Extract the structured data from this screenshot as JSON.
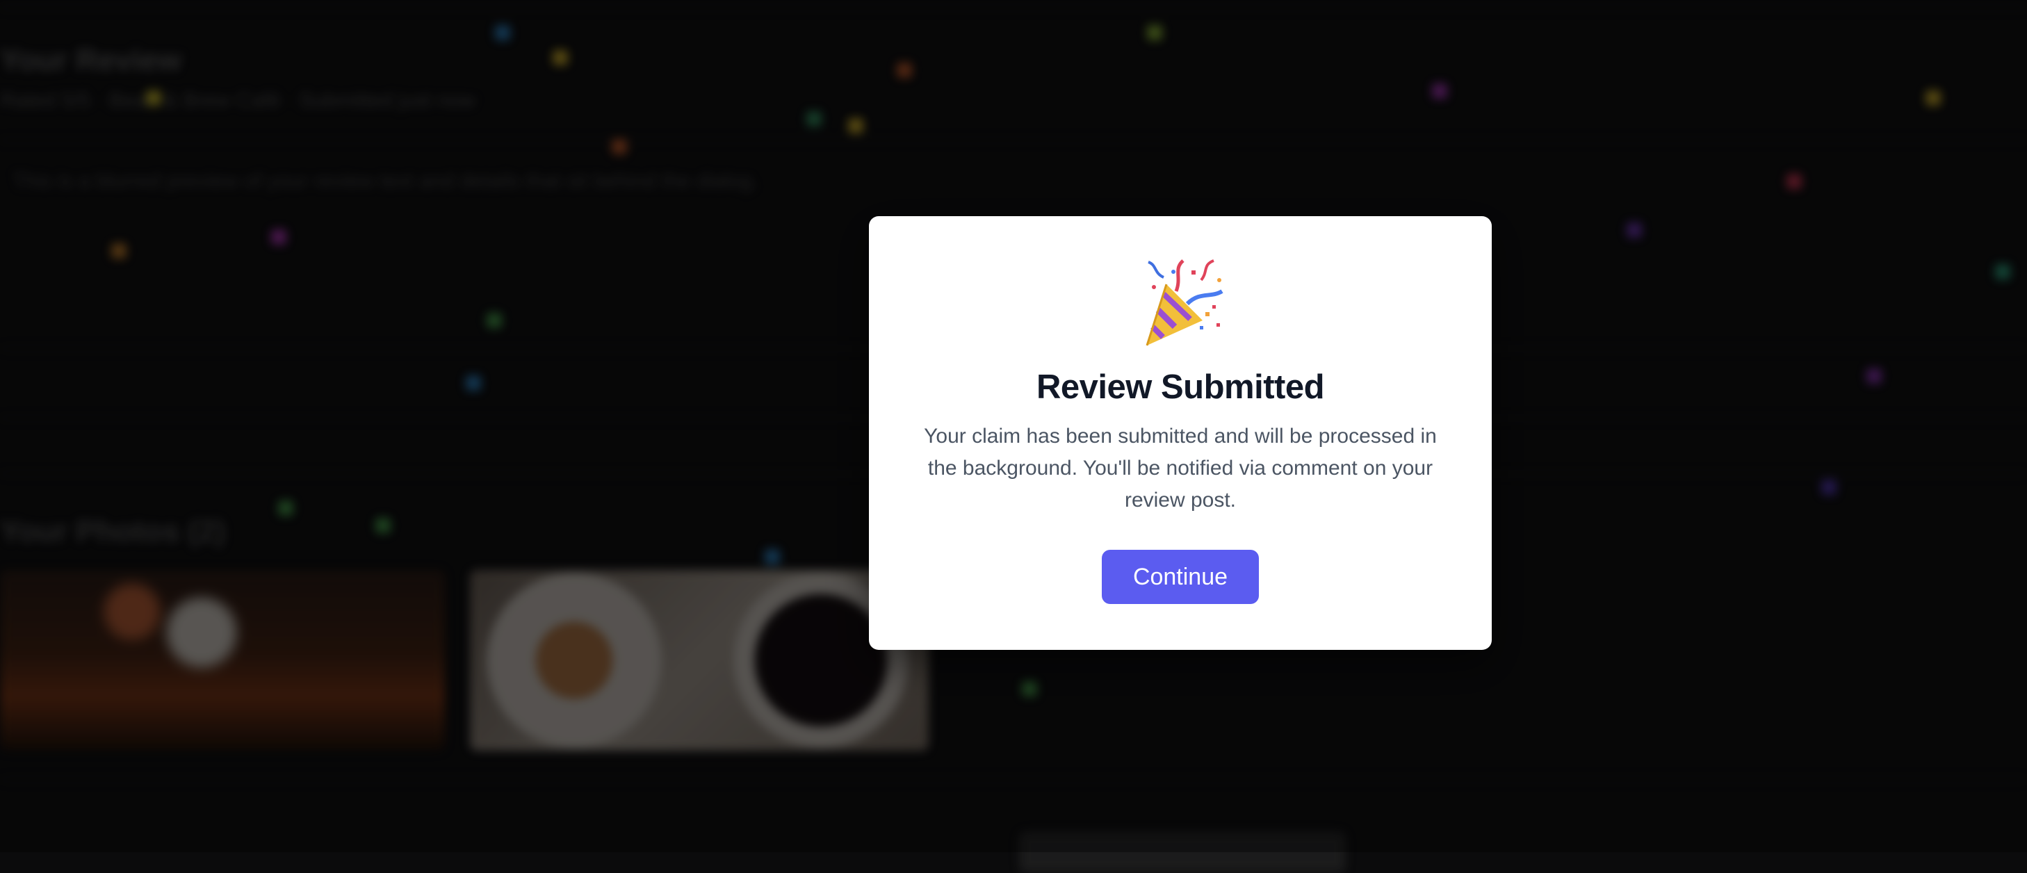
{
  "background": {
    "heading": "Your Review",
    "subtitle": "Rated 5/5 · Bean & Brew Café · Submitted just now",
    "description": "This is a blurred preview of your review text and details that sit behind the dialog.",
    "photos_heading": "Your Photos (2)"
  },
  "modal": {
    "icon": "party-popper-icon",
    "title": "Review Submitted",
    "message": "Your claim has been submitted and will be processed in the background. You'll be notified via comment on your review post.",
    "button_label": "Continue"
  },
  "colors": {
    "accent": "#5b5cf0",
    "title": "#111827",
    "body": "#4b5563",
    "backdrop": "#0b0b0c"
  }
}
